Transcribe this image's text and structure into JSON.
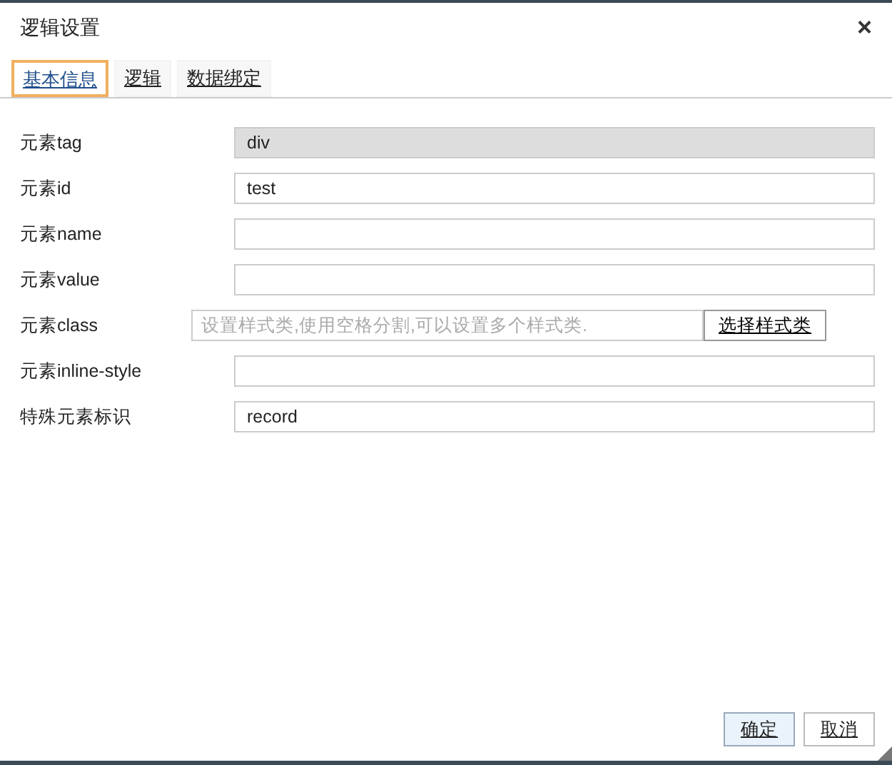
{
  "window": {
    "title": "逻辑设置",
    "close": "×"
  },
  "tabs": [
    {
      "label": "基本信息",
      "selected": true
    },
    {
      "label": "逻辑",
      "selected": false
    },
    {
      "label": "数据绑定",
      "selected": false
    }
  ],
  "fields": [
    {
      "kind": "text",
      "label": "元素tag",
      "value": "div",
      "disabled": true
    },
    {
      "kind": "text",
      "label": "元素id",
      "value": "test",
      "disabled": false
    },
    {
      "kind": "text",
      "label": "元素name",
      "disabled": false
    },
    {
      "kind": "text",
      "label": "元素value",
      "disabled": false
    },
    {
      "kind": "picker",
      "label": "元素class",
      "placeholder": "设置样式类,使用空格分割,可以设置多个样式类.",
      "button": "选择样式类",
      "disabled": false
    },
    {
      "kind": "text",
      "label": "元素inline-style",
      "disabled": false
    },
    {
      "kind": "text",
      "label": "特殊元素标识",
      "value": "record",
      "disabled": false
    }
  ],
  "buttons": [
    {
      "label": "确定",
      "primary": true
    },
    {
      "label": "取消",
      "primary": false
    }
  ]
}
